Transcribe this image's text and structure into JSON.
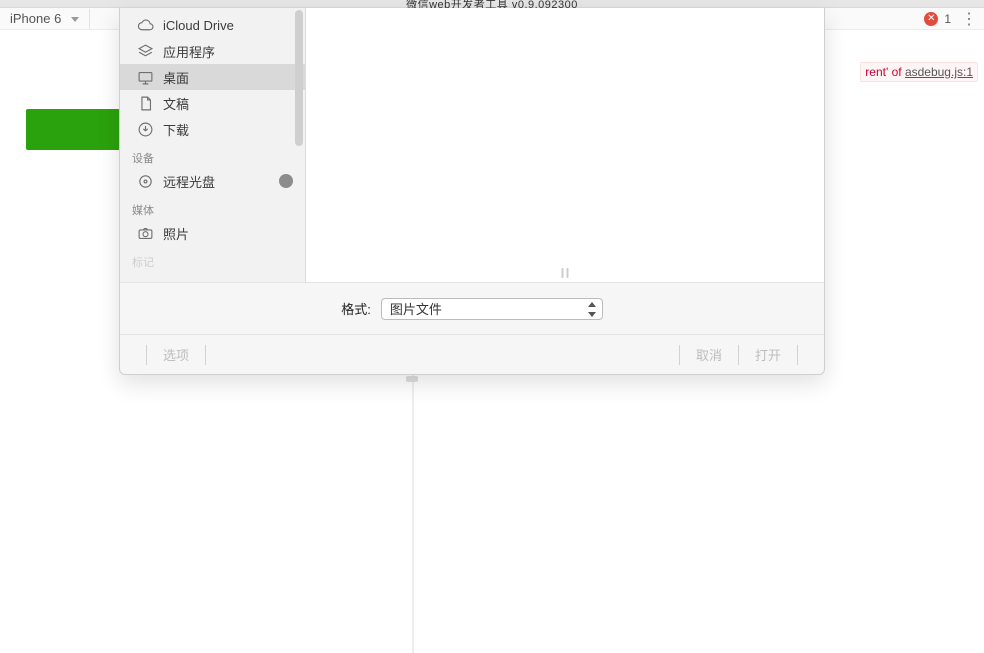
{
  "top": {
    "title": "微信web开发者工具 v0.9.092300"
  },
  "subbar": {
    "device": "iPhone 6",
    "error_count": "1"
  },
  "error_fragment": {
    "text": "rent' of ",
    "source": "asdebug.js:1"
  },
  "sidebar": {
    "favorites": [
      {
        "id": "icloud",
        "label": "iCloud Drive",
        "icon": "cloud-icon"
      },
      {
        "id": "apps",
        "label": "应用程序",
        "icon": "apps-icon"
      },
      {
        "id": "desktop",
        "label": "桌面",
        "icon": "desktop-icon",
        "active": true
      },
      {
        "id": "docs",
        "label": "文稿",
        "icon": "document-icon"
      },
      {
        "id": "downloads",
        "label": "下载",
        "icon": "download-icon"
      }
    ],
    "section_devices": "设备",
    "devices": [
      {
        "id": "remotedisc",
        "label": "远程光盘",
        "icon": "disc-icon",
        "eject": true
      }
    ],
    "section_media": "媒体",
    "media": [
      {
        "id": "photos",
        "label": "照片",
        "icon": "camera-icon"
      }
    ],
    "section_tags": "标记"
  },
  "format": {
    "label": "格式:",
    "value": "图片文件"
  },
  "actions": {
    "options": "选项",
    "cancel": "取消",
    "open": "打开"
  }
}
